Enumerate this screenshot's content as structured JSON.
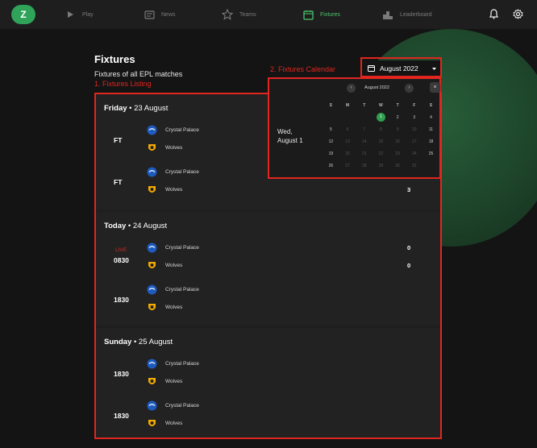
{
  "nav": {
    "logo": "Z",
    "items": [
      {
        "label": "Play",
        "icon": "play-icon"
      },
      {
        "label": "News",
        "icon": "news-icon"
      },
      {
        "label": "Teams",
        "icon": "star-icon"
      },
      {
        "label": "Fixtures",
        "icon": "calendar-icon"
      },
      {
        "label": "Leaderboard",
        "icon": "podium-icon"
      }
    ],
    "active": "Fixtures"
  },
  "header": {
    "title": "Fixtures",
    "subtitle": "Fixtures of all EPL matches",
    "month_select": "August 2022"
  },
  "annotations": {
    "listing": "1. Fixtures Listing",
    "calendar": "2. Fixtures Calendar"
  },
  "sections": [
    {
      "day": "Friday",
      "date": "23 August",
      "matches": [
        {
          "status": "FT",
          "live": "",
          "home": "Crystal Palace",
          "away": "Wolves",
          "home_score": "",
          "away_score": ""
        },
        {
          "status": "FT",
          "live": "",
          "home": "Crystal Palace",
          "away": "Wolves",
          "home_score": "",
          "away_score": "3"
        }
      ]
    },
    {
      "day": "Today",
      "date": "24 August",
      "matches": [
        {
          "status": "0830",
          "live": "LIVE",
          "home": "Crystal Palace",
          "away": "Wolves",
          "home_score": "0",
          "away_score": "0"
        },
        {
          "status": "1830",
          "live": "",
          "home": "Crystal Palace",
          "away": "Wolves",
          "home_score": "",
          "away_score": ""
        }
      ]
    },
    {
      "day": "Sunday",
      "date": "25 August",
      "matches": [
        {
          "status": "1830",
          "live": "",
          "home": "Crystal Palace",
          "away": "Wolves",
          "home_score": "",
          "away_score": ""
        },
        {
          "status": "1830",
          "live": "",
          "home": "Crystal Palace",
          "away": "Wolves",
          "home_score": "",
          "away_score": ""
        }
      ]
    }
  ],
  "calendar": {
    "month": "August 2022",
    "prev": "‹",
    "next": "›",
    "close": "×",
    "selected_weekday": "Wed,",
    "selected_date": "August 1",
    "weekdays": [
      "S",
      "M",
      "T",
      "W",
      "T",
      "F",
      "S"
    ],
    "weeks": [
      [
        "",
        "",
        "",
        "1",
        "2",
        "3",
        "4"
      ],
      [
        "5",
        "6",
        "7",
        "8",
        "9",
        "10",
        "11"
      ],
      [
        "12",
        "13",
        "14",
        "15",
        "16",
        "17",
        "18"
      ],
      [
        "19",
        "20",
        "21",
        "22",
        "23",
        "24",
        "25"
      ],
      [
        "26",
        "27",
        "28",
        "29",
        "30",
        "31",
        ""
      ]
    ],
    "selected_day": "1",
    "highlight_days": [
      "1",
      "2",
      "3",
      "4",
      "11",
      "18",
      "25",
      "5",
      "12",
      "19",
      "26"
    ]
  },
  "colors": {
    "accent": "#4bc46d",
    "annotation": "#e0261f",
    "live": "#e0261f"
  }
}
